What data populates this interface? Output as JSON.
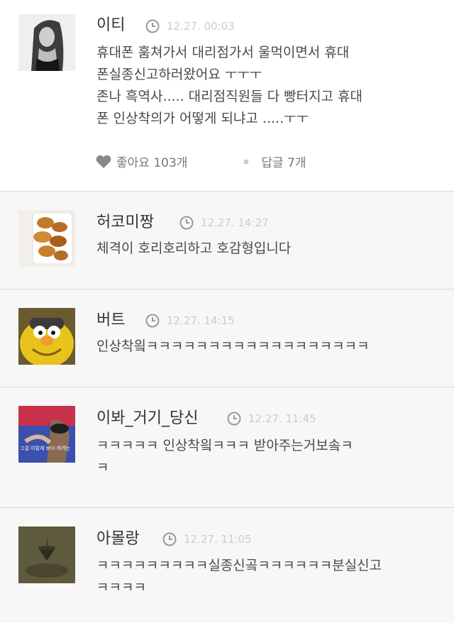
{
  "main_comment": {
    "author": "이티",
    "time": "12.27. 00:03",
    "text": "휴대폰 훔쳐가서 대리점가서 울먹이면서 휴대\n폰실종신고하러왔어요 ㅜㅜㅜ\n존나 흑역사..... 대리점직원들 다 빵터지고 휴대\n폰 인상착의가 어떻게 되냐고 .....ㅜㅜ",
    "like_label": "좋아요 103개",
    "reply_label": "답글 7개"
  },
  "replies": [
    {
      "author": "허코미짱",
      "time": "12.27. 14:27",
      "text": "체격이 호리호리하고 호감형입니다"
    },
    {
      "author": "버트",
      "time": "12.27. 14:15",
      "text": "인상착읰ㅋㅋㅋㅋㅋㅋㅋㅋㅋㅋㅋㅋㅋㅋㅋㅋㅋㅋ"
    },
    {
      "author": "이봐_거기_당신",
      "time": "12.27. 11:45",
      "text": "ㅋㅋㅋㅋㅋ 인상착읰ㅋㅋㅋ 받아주는거보솤ㅋ\nㅋ",
      "avatar_caption": "그걸 이렇게 보다 하려는"
    },
    {
      "author": "아몰랑",
      "time": "12.27. 11:05",
      "text": "ㅋㅋㅋㅋㅋㅋㅋㅋㅋ실종신곸ㅋㅋㅋㅋㅋㅋ분실신고\nㅋㅋㅋㅋ"
    }
  ],
  "icons": {
    "clock": "clock-icon",
    "heart": "heart-icon"
  },
  "colors": {
    "time": "#cccccc",
    "divider": "#d9d9d9",
    "reply_bg": "#f7f7f7"
  }
}
